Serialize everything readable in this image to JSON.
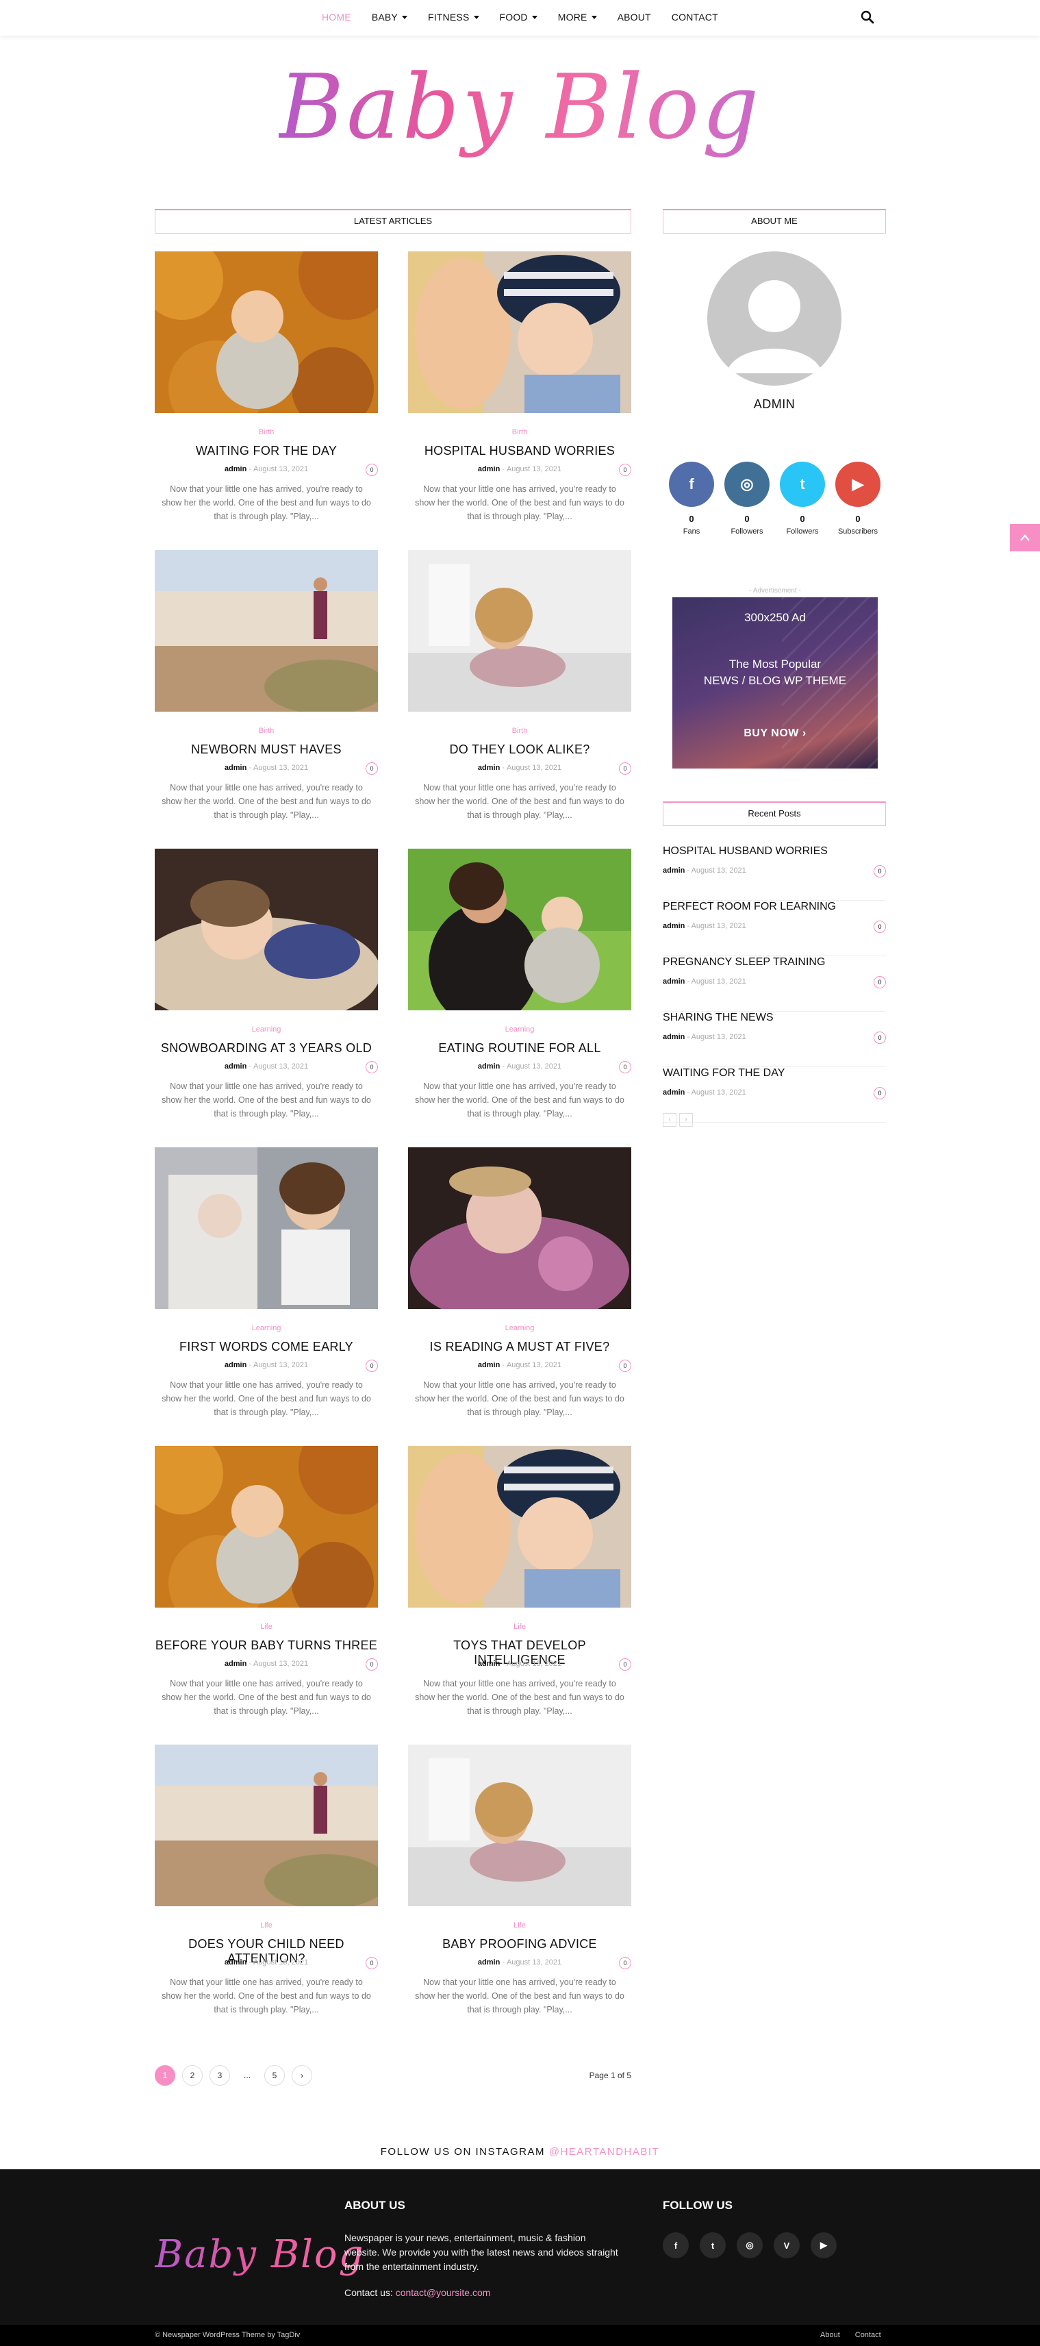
{
  "nav": {
    "items": [
      "HOME",
      "BABY",
      "FITNESS",
      "FOOD",
      "MORE",
      "ABOUT",
      "CONTACT"
    ],
    "active": "HOME",
    "search_icon": "search-icon"
  },
  "logo_text": "Baby Blog",
  "main_title": "LATEST ARTICLES",
  "articles": [
    {
      "category": "Birth",
      "title": "WAITING FOR THE DAY",
      "author": "admin",
      "date": "August 13, 2021",
      "comments": "0",
      "excerpt": "Now that your little one has arrived, you're ready to show her the world. One of the best and fun ways to do that is through play. \"Play,..."
    },
    {
      "category": "Birth",
      "title": "HOSPITAL HUSBAND WORRIES",
      "author": "admin",
      "date": "August 13, 2021",
      "comments": "0",
      "excerpt": "Now that your little one has arrived, you're ready to show her the world. One of the best and fun ways to do that is through play. \"Play,..."
    },
    {
      "category": "Birth",
      "title": "NEWBORN MUST HAVES",
      "author": "admin",
      "date": "August 13, 2021",
      "comments": "0",
      "excerpt": "Now that your little one has arrived, you're ready to show her the world. One of the best and fun ways to do that is through play. \"Play,..."
    },
    {
      "category": "Birth",
      "title": "DO THEY LOOK ALIKE?",
      "author": "admin",
      "date": "August 13, 2021",
      "comments": "0",
      "excerpt": "Now that your little one has arrived, you're ready to show her the world. One of the best and fun ways to do that is through play. \"Play,..."
    },
    {
      "category": "Learning",
      "title": "SNOWBOARDING AT 3 YEARS OLD",
      "author": "admin",
      "date": "August 13, 2021",
      "comments": "0",
      "excerpt": "Now that your little one has arrived, you're ready to show her the world. One of the best and fun ways to do that is through play. \"Play,..."
    },
    {
      "category": "Learning",
      "title": "EATING ROUTINE FOR ALL",
      "author": "admin",
      "date": "August 13, 2021",
      "comments": "0",
      "excerpt": "Now that your little one has arrived, you're ready to show her the world. One of the best and fun ways to do that is through play. \"Play,..."
    },
    {
      "category": "Learning",
      "title": "FIRST WORDS COME EARLY",
      "author": "admin",
      "date": "August 13, 2021",
      "comments": "0",
      "excerpt": "Now that your little one has arrived, you're ready to show her the world. One of the best and fun ways to do that is through play. \"Play,..."
    },
    {
      "category": "Learning",
      "title": "IS READING A MUST AT FIVE?",
      "author": "admin",
      "date": "August 13, 2021",
      "comments": "0",
      "excerpt": "Now that your little one has arrived, you're ready to show her the world. One of the best and fun ways to do that is through play. \"Play,..."
    },
    {
      "category": "Life",
      "title": "BEFORE YOUR BABY TURNS THREE",
      "author": "admin",
      "date": "August 13, 2021",
      "comments": "0",
      "excerpt": "Now that your little one has arrived, you're ready to show her the world. One of the best and fun ways to do that is through play. \"Play,..."
    },
    {
      "category": "Life",
      "title": "TOYS THAT DEVELOP INTELLIGENCE",
      "author": "admin",
      "date": "August 13, 2021",
      "comments": "0",
      "excerpt": "Now that your little one has arrived, you're ready to show her the world. One of the best and fun ways to do that is through play. \"Play,..."
    },
    {
      "category": "Life",
      "title": "DOES YOUR CHILD NEED ATTENTION?",
      "author": "admin",
      "date": "August 13, 2021",
      "comments": "0",
      "excerpt": "Now that your little one has arrived, you're ready to show her the world. One of the best and fun ways to do that is through play. \"Play,..."
    },
    {
      "category": "Life",
      "title": "BABY PROOFING ADVICE",
      "author": "admin",
      "date": "August 13, 2021",
      "comments": "0",
      "excerpt": "Now that your little one has arrived, you're ready to show her the world. One of the best and fun ways to do that is through play. \"Play,..."
    }
  ],
  "sidebar": {
    "about_title": "ABOUT ME",
    "admin_name": "ADMIN",
    "social": [
      {
        "icon": "facebook-icon",
        "glyph": "f",
        "color": "#516eab",
        "count": "0",
        "label": "Fans"
      },
      {
        "icon": "instagram-icon",
        "glyph": "◎",
        "color": "#417096",
        "count": "0",
        "label": "Followers"
      },
      {
        "icon": "twitter-icon",
        "glyph": "t",
        "color": "#29c5f6",
        "count": "0",
        "label": "Followers"
      },
      {
        "icon": "youtube-icon",
        "glyph": "▶",
        "color": "#e14e42",
        "count": "0",
        "label": "Subscribers"
      }
    ],
    "ad_label": "- Advertisement -",
    "ad": {
      "size": "300x250 Ad",
      "line1": "The Most Popular",
      "line2": "NEWS / BLOG WP THEME",
      "cta": "BUY NOW ›"
    },
    "recent_title": "Recent Posts",
    "recent": [
      {
        "title": "HOSPITAL HUSBAND WORRIES",
        "author": "admin",
        "date": "August 13, 2021",
        "comments": "0"
      },
      {
        "title": "PERFECT ROOM FOR LEARNING",
        "author": "admin",
        "date": "August 13, 2021",
        "comments": "0"
      },
      {
        "title": "PREGNANCY SLEEP TRAINING",
        "author": "admin",
        "date": "August 13, 2021",
        "comments": "0"
      },
      {
        "title": "SHARING THE NEWS",
        "author": "admin",
        "date": "August 13, 2021",
        "comments": "0"
      },
      {
        "title": "WAITING FOR THE DAY",
        "author": "admin",
        "date": "August 13, 2021",
        "comments": "0"
      }
    ],
    "prev": "‹",
    "next": "›"
  },
  "pagination": {
    "pages": [
      "1",
      "2",
      "3",
      "...",
      "5"
    ],
    "active": "1",
    "next": "›",
    "page_of": "Page 1 of 5"
  },
  "instagram": {
    "prefix": "FOLLOW US ON INSTAGRAM",
    "handle": "@HEARTANDHABIT"
  },
  "footer": {
    "logo": "Baby Blog",
    "about_title": "ABOUT US",
    "about_text": "Newspaper is your news, entertainment, music & fashion website. We provide you with the latest news and videos straight from the entertainment industry.",
    "contact_label": "Contact us:",
    "contact_email": "contact@yoursite.com",
    "follow_title": "FOLLOW US",
    "icons": [
      {
        "icon": "facebook-icon",
        "glyph": "f"
      },
      {
        "icon": "twitter-icon",
        "glyph": "t"
      },
      {
        "icon": "instagram-icon",
        "glyph": "◎"
      },
      {
        "icon": "vimeo-icon",
        "glyph": "V"
      },
      {
        "icon": "youtube-icon",
        "glyph": "▶"
      }
    ],
    "copyright": "© Newspaper WordPress Theme by TagDiv",
    "links": [
      "About",
      "Contact"
    ]
  },
  "to_top_icon": "arrow-up-icon"
}
